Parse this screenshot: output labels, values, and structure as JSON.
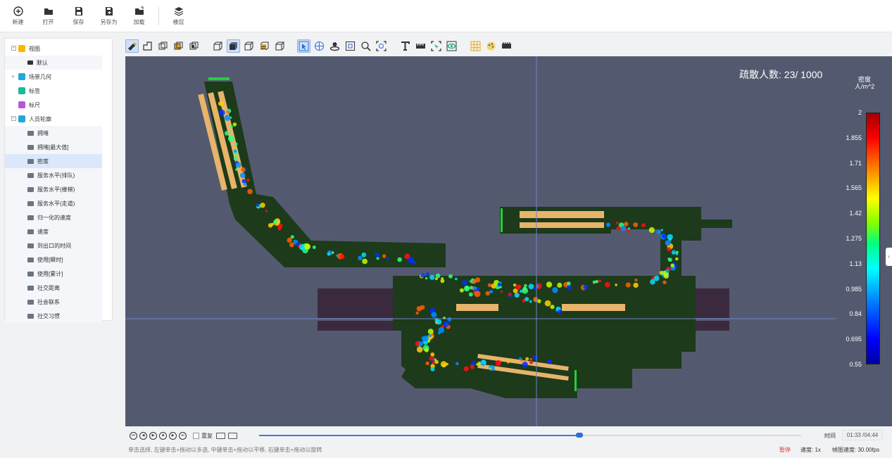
{
  "toolbar": {
    "items": [
      {
        "label": "新建",
        "icon": "plus-circle-icon"
      },
      {
        "label": "打开",
        "icon": "folder-icon"
      },
      {
        "label": "保存",
        "icon": "save-icon"
      },
      {
        "label": "另存为",
        "icon": "save-as-icon"
      },
      {
        "label": "加载",
        "icon": "load-icon"
      },
      {
        "label": "楼层",
        "icon": "layers-icon"
      }
    ]
  },
  "tree": {
    "view": "视图",
    "default": "默认",
    "geometry": "场景几何",
    "labels": "标签",
    "ruler": "标尺",
    "people_contours": "人员轮廓",
    "items": [
      "拥堵",
      "拥堵[最大值]",
      "密度",
      "服务水平(排队)",
      "服务水平(楼梯)",
      "服务水平(走道)",
      "归一化的速度",
      "速度",
      "到出口的时间",
      "使用[瞬时]",
      "使用[累计]",
      "社交距离",
      "社会联系",
      "社交习惯"
    ],
    "selected_index": 2
  },
  "viewport": {
    "evac_label": "疏散人数: 23/ 1000",
    "legend_title_1": "密度",
    "legend_title_2": "人/m^2",
    "legend_ticks": [
      "2",
      "1.855",
      "1.71",
      "1.565",
      "1.42",
      "1.275",
      "1.13",
      "0.985",
      "0.84",
      "0.695",
      "0.55"
    ],
    "bg_color": "#535a70",
    "floor_color": "#1d3a1a"
  },
  "playback": {
    "replay_label": "重复",
    "progress": 0.591,
    "time_label": "时间",
    "time_value": "01:33 /04:44"
  },
  "status": {
    "hint": "单击选择, 左键单击+拖动以多选, 中键单击+拖动以平移, 右键单击+拖动以旋转",
    "pause": "暂停",
    "speed": "速度: 1x",
    "fps": "帧图速度: 30.00fps"
  }
}
